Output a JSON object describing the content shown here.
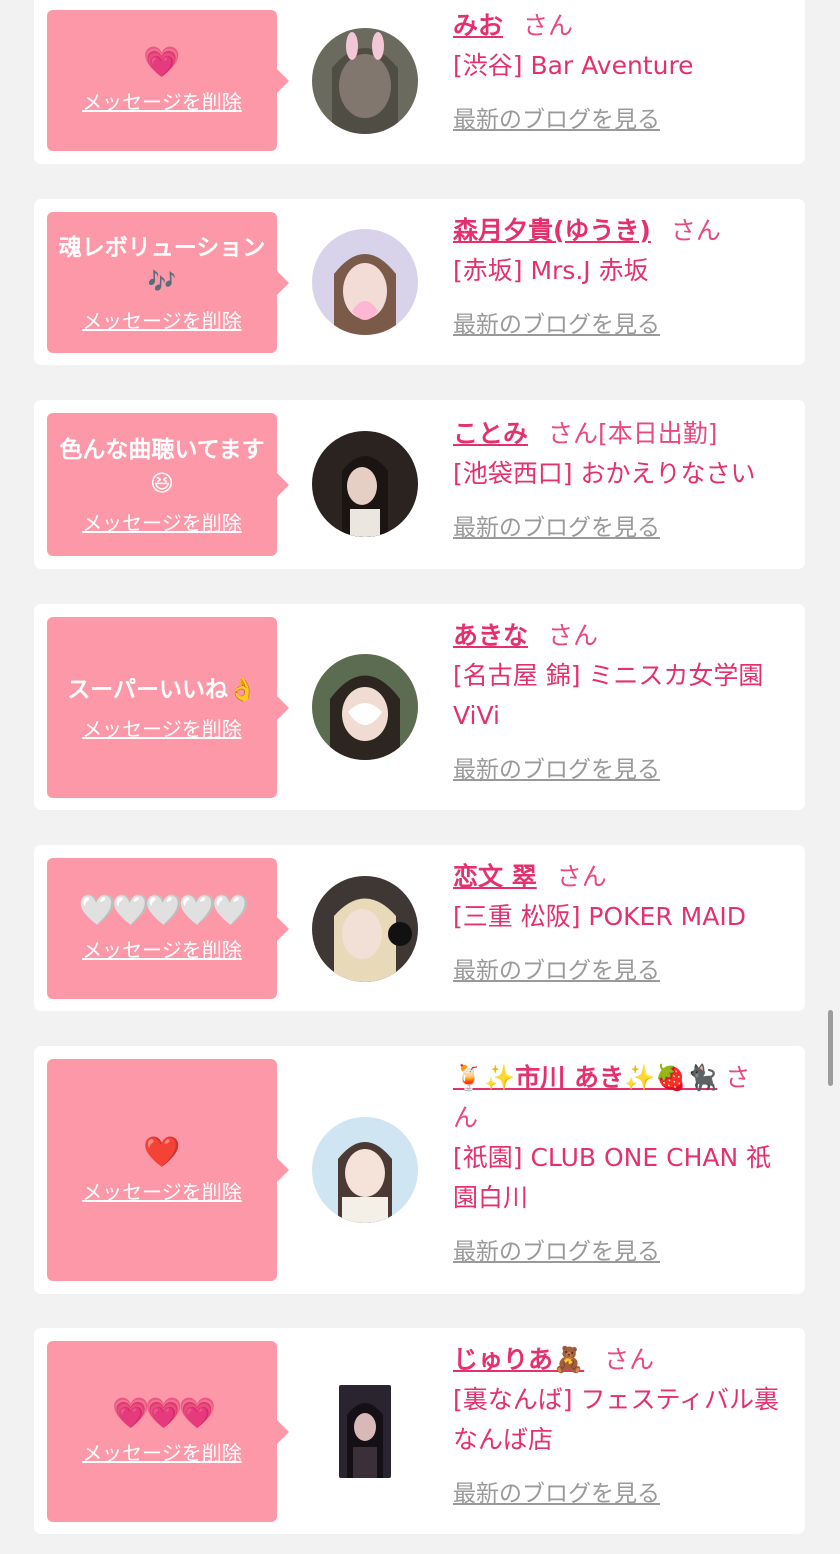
{
  "colors": {
    "background": "#f2f2f2",
    "card": "#ffffff",
    "bubble": "#fd98a8",
    "name": "#e5306e",
    "link_gray": "#9a9a9a"
  },
  "common": {
    "delete_label": "メッセージを削除",
    "san_label": "さん",
    "blog_label": "最新のブログを見る"
  },
  "items": [
    {
      "message": "💗",
      "name": "みお",
      "extra": "",
      "shop": "[渋谷] Bar Aventure",
      "avatar_icon": "profile-photo"
    },
    {
      "message": "魂レボリューション🎶",
      "name": "森月夕貴(ゆうき)",
      "extra": "",
      "shop": "[赤坂] Mrs.J 赤坂",
      "avatar_icon": "profile-photo"
    },
    {
      "message": "色んな曲聴いてます😆",
      "name": "ことみ",
      "extra": "[本日出勤]",
      "shop": "[池袋西口] おかえりなさい",
      "avatar_icon": "profile-photo"
    },
    {
      "message": "スーパーいいね👌",
      "name": "あきな",
      "extra": "",
      "shop": "[名古屋 錦] ミニスカ女学園ViVi",
      "avatar_icon": "profile-photo"
    },
    {
      "message": "🤍🤍🤍🤍🤍",
      "name": "恋文 翠",
      "extra": "",
      "shop": "[三重 松阪] POKER MAID",
      "avatar_icon": "profile-photo"
    },
    {
      "message": "❤️",
      "name": "🍹✨市川 あき✨🍓🐈‍⬛",
      "extra": "",
      "shop": "[祇園] CLUB ONE CHAN 祇園白川",
      "avatar_icon": "profile-photo"
    },
    {
      "message": "💗💗💗",
      "name": "じゅりあ🧸",
      "extra": "",
      "shop": "[裏なんば] フェスティバル裏なんば店",
      "avatar_icon": "profile-photo"
    }
  ]
}
